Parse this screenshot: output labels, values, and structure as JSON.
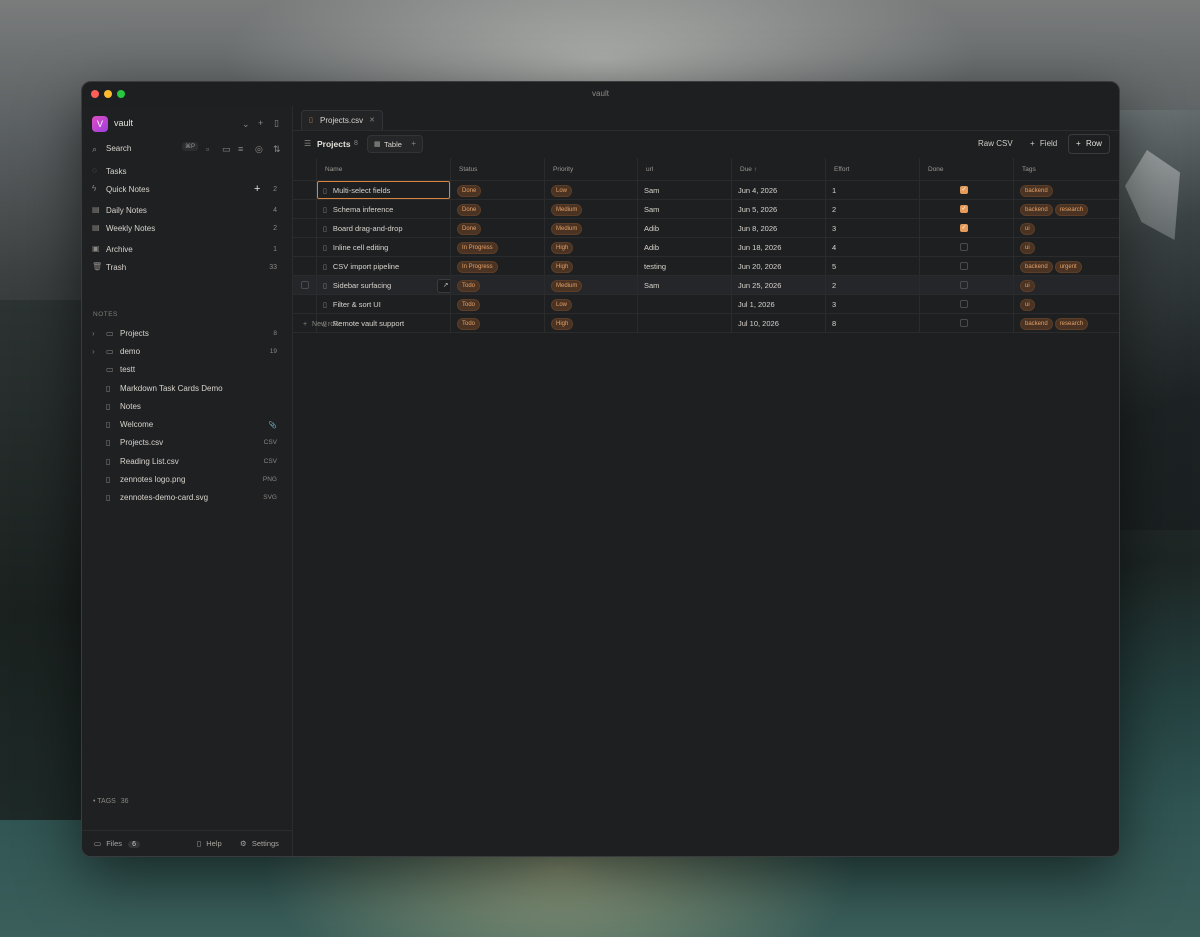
{
  "window": {
    "title": "vault"
  },
  "sidebar": {
    "vault_name": "vault",
    "vault_initial": "V",
    "search_label": "Search",
    "search_shortcut": "⌘P",
    "nav": [
      {
        "label": "Tasks",
        "icon": "circle-check-icon",
        "count": ""
      },
      {
        "label": "Quick Notes",
        "icon": "lightning-icon",
        "count": "2"
      },
      {
        "label": "Daily Notes",
        "icon": "calendar-icon",
        "count": "4"
      },
      {
        "label": "Weekly Notes",
        "icon": "calendar-icon",
        "count": "2"
      },
      {
        "label": "Archive",
        "icon": "archive-icon",
        "count": "1"
      },
      {
        "label": "Trash",
        "icon": "trash-icon",
        "count": "33"
      }
    ],
    "notes_section": "NOTES",
    "tree": [
      {
        "label": "Projects",
        "type": "folder",
        "expandable": true,
        "ext": "8"
      },
      {
        "label": "demo",
        "type": "folder",
        "expandable": true,
        "ext": "19"
      },
      {
        "label": "testt",
        "type": "folder",
        "expandable": false,
        "ext": ""
      },
      {
        "label": "Markdown Task Cards Demo",
        "type": "file",
        "expandable": false,
        "ext": ""
      },
      {
        "label": "Notes",
        "type": "file",
        "expandable": false,
        "ext": ""
      },
      {
        "label": "Welcome",
        "type": "file",
        "expandable": false,
        "ext": "📎"
      },
      {
        "label": "Projects.csv",
        "type": "file",
        "expandable": false,
        "ext": "CSV"
      },
      {
        "label": "Reading List.csv",
        "type": "file",
        "expandable": false,
        "ext": "CSV"
      },
      {
        "label": "zennotes logo.png",
        "type": "file",
        "expandable": false,
        "ext": "PNG"
      },
      {
        "label": "zennotes-demo-card.svg",
        "type": "file",
        "expandable": false,
        "ext": "SVG"
      }
    ],
    "tags_label": "• TAGS",
    "tags_count": "36",
    "footer": {
      "files_label": "Files",
      "files_count": "6",
      "help_label": "Help",
      "settings_label": "Settings"
    }
  },
  "main": {
    "tab_label": "Projects.csv",
    "db_title": "Projects",
    "db_count": "8",
    "view_label": "Table",
    "raw_csv_label": "Raw CSV",
    "field_label": "Field",
    "row_label": "Row",
    "new_row_label": "New row",
    "columns": [
      "Name",
      "Status",
      "Priority",
      "url",
      "Due ↑",
      "Effort",
      "Done",
      "Tags"
    ],
    "open_label": "Open",
    "rows": [
      {
        "name": "Multi-select fields",
        "status": "Done",
        "priority": "Low",
        "url": "Sam",
        "due": "Jun 4, 2026",
        "effort": "1",
        "done": true,
        "tags": [
          "backend"
        ]
      },
      {
        "name": "Schema inference",
        "status": "Done",
        "priority": "Medium",
        "url": "Sam",
        "due": "Jun 5, 2026",
        "effort": "2",
        "done": true,
        "tags": [
          "backend",
          "research"
        ]
      },
      {
        "name": "Board drag-and-drop",
        "status": "Done",
        "priority": "Medium",
        "url": "Adib",
        "due": "Jun 8, 2026",
        "effort": "3",
        "done": true,
        "tags": [
          "ui"
        ]
      },
      {
        "name": "Inline cell editing",
        "status": "In Progress",
        "priority": "High",
        "url": "Adib",
        "due": "Jun 18, 2026",
        "effort": "4",
        "done": false,
        "tags": [
          "ui"
        ]
      },
      {
        "name": "CSV import pipeline",
        "status": "In Progress",
        "priority": "High",
        "url": "testing",
        "due": "Jun 20, 2026",
        "effort": "5",
        "done": false,
        "tags": [
          "backend",
          "urgent"
        ]
      },
      {
        "name": "Sidebar surfacing",
        "status": "Todo",
        "priority": "Medium",
        "url": "Sam",
        "due": "Jun 25, 2026",
        "effort": "2",
        "done": false,
        "tags": [
          "ui"
        ]
      },
      {
        "name": "Filter & sort UI",
        "status": "Todo",
        "priority": "Low",
        "url": "",
        "due": "Jul 1, 2026",
        "effort": "3",
        "done": false,
        "tags": [
          "ui"
        ]
      },
      {
        "name": "Remote vault support",
        "status": "Todo",
        "priority": "High",
        "url": "",
        "due": "Jul 10, 2026",
        "effort": "8",
        "done": false,
        "tags": [
          "backend",
          "research"
        ]
      }
    ]
  },
  "colors": {
    "accent": "#e79b5a",
    "pill_bg": "#4a3322",
    "pill_text": "#e3a06a"
  }
}
